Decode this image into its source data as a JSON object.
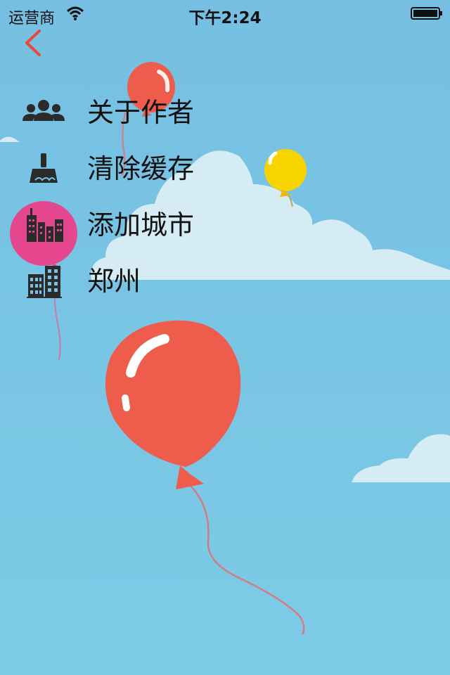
{
  "status_bar": {
    "carrier": "运营商",
    "time": "下午2:24"
  },
  "nav": {
    "back_icon": "chevron-left-icon",
    "accent_color": "#e8493a"
  },
  "menu": {
    "items": [
      {
        "label": "关于作者",
        "icon": "group-users-icon"
      },
      {
        "label": "清除缓存",
        "icon": "broom-icon"
      },
      {
        "label": "添加城市",
        "icon": "city-skyline-icon"
      },
      {
        "label": "郑州",
        "icon": "building-icon"
      }
    ]
  },
  "colors": {
    "sky": "#78c3e3",
    "cloud": "#d6ecf4",
    "balloon_red": "#ee5c4b",
    "balloon_pink": "#e5478e",
    "balloon_yellow": "#f7d300",
    "icon": "#2b2b2b"
  }
}
